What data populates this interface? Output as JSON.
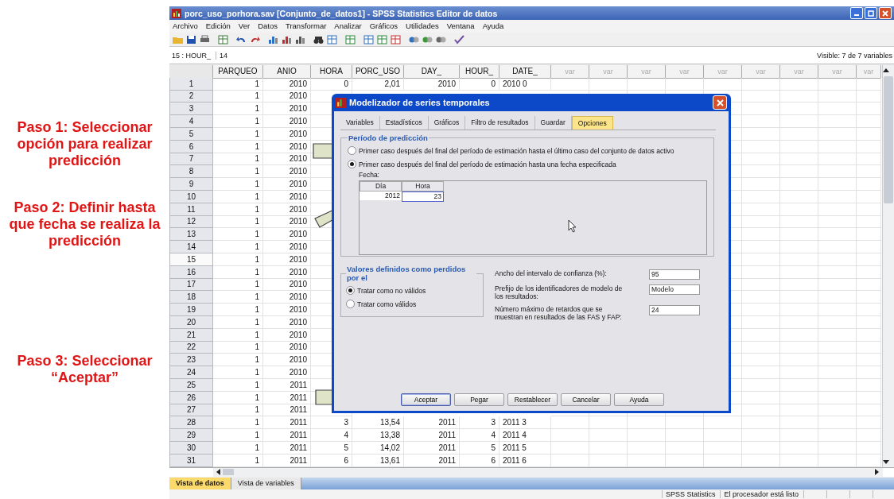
{
  "annotations": [
    "Paso 1: Seleccionar opción para realizar predicción",
    "Paso 2: Definir hasta que fecha se realiza la predicción",
    "Paso 3: Seleccionar “Aceptar”"
  ],
  "window": {
    "title": "porc_uso_porhora.sav [Conjunto_de_datos1] - SPSS Statistics Editor de datos",
    "menu": [
      "Archivo",
      "Edición",
      "Ver",
      "Datos",
      "Transformar",
      "Analizar",
      "Gráficos",
      "Utilidades",
      "Ventana",
      "Ayuda"
    ],
    "cell_ref": "15 : HOUR_",
    "cell_value": "14",
    "visible_info": "Visible: 7 de 7 variables"
  },
  "grid": {
    "columns": [
      "PARQUEO",
      "ANIO",
      "HORA",
      "PORC_USO",
      "DAY_",
      "HOUR_",
      "DATE_",
      "var",
      "var",
      "var",
      "var",
      "var",
      "var",
      "var",
      "var",
      "var"
    ],
    "rows": [
      {
        "n": "1",
        "selected": false,
        "cells": [
          "1",
          "2010",
          "0",
          "2,01",
          "2010",
          "0",
          "2010 0"
        ]
      },
      {
        "n": "2",
        "selected": false,
        "cells": [
          "1",
          "2010"
        ]
      },
      {
        "n": "3",
        "selected": false,
        "cells": [
          "1",
          "2010"
        ]
      },
      {
        "n": "4",
        "selected": false,
        "cells": [
          "1",
          "2010"
        ]
      },
      {
        "n": "5",
        "selected": false,
        "cells": [
          "1",
          "2010"
        ]
      },
      {
        "n": "6",
        "selected": false,
        "cells": [
          "1",
          "2010"
        ]
      },
      {
        "n": "7",
        "selected": false,
        "cells": [
          "1",
          "2010"
        ]
      },
      {
        "n": "8",
        "selected": false,
        "cells": [
          "1",
          "2010"
        ]
      },
      {
        "n": "9",
        "selected": false,
        "cells": [
          "1",
          "2010"
        ]
      },
      {
        "n": "10",
        "selected": false,
        "cells": [
          "1",
          "2010"
        ]
      },
      {
        "n": "11",
        "selected": false,
        "cells": [
          "1",
          "2010"
        ]
      },
      {
        "n": "12",
        "selected": false,
        "cells": [
          "1",
          "2010"
        ]
      },
      {
        "n": "13",
        "selected": false,
        "cells": [
          "1",
          "2010"
        ]
      },
      {
        "n": "14",
        "selected": false,
        "cells": [
          "1",
          "2010"
        ]
      },
      {
        "n": "15",
        "selected": true,
        "cells": [
          "1",
          "2010"
        ]
      },
      {
        "n": "16",
        "selected": false,
        "cells": [
          "1",
          "2010"
        ]
      },
      {
        "n": "17",
        "selected": false,
        "cells": [
          "1",
          "2010"
        ]
      },
      {
        "n": "18",
        "selected": false,
        "cells": [
          "1",
          "2010"
        ]
      },
      {
        "n": "19",
        "selected": false,
        "cells": [
          "1",
          "2010"
        ]
      },
      {
        "n": "20",
        "selected": false,
        "cells": [
          "1",
          "2010"
        ]
      },
      {
        "n": "21",
        "selected": false,
        "cells": [
          "1",
          "2010"
        ]
      },
      {
        "n": "22",
        "selected": false,
        "cells": [
          "1",
          "2010"
        ]
      },
      {
        "n": "23",
        "selected": false,
        "cells": [
          "1",
          "2010"
        ]
      },
      {
        "n": "24",
        "selected": false,
        "cells": [
          "1",
          "2010"
        ]
      },
      {
        "n": "25",
        "selected": false,
        "cells": [
          "1",
          "2011"
        ]
      },
      {
        "n": "26",
        "selected": false,
        "cells": [
          "1",
          "2011"
        ]
      },
      {
        "n": "27",
        "selected": false,
        "cells": [
          "1",
          "2011"
        ]
      },
      {
        "n": "28",
        "selected": false,
        "cells": [
          "1",
          "2011",
          "3",
          "13,54",
          "2011",
          "3",
          "2011 3"
        ]
      },
      {
        "n": "29",
        "selected": false,
        "cells": [
          "1",
          "2011",
          "4",
          "13,38",
          "2011",
          "4",
          "2011 4"
        ]
      },
      {
        "n": "30",
        "selected": false,
        "cells": [
          "1",
          "2011",
          "5",
          "14,02",
          "2011",
          "5",
          "2011 5"
        ]
      },
      {
        "n": "31",
        "selected": false,
        "cells": [
          "1",
          "2011",
          "6",
          "13,61",
          "2011",
          "6",
          "2011 6"
        ]
      }
    ]
  },
  "view_tabs": [
    {
      "label": "Vista de datos",
      "selected": true
    },
    {
      "label": "Vista de variables",
      "selected": false
    }
  ],
  "status_bar": [
    "SPSS Statistics",
    "El procesador está listo"
  ],
  "dialog": {
    "title": "Modelizador de series temporales",
    "tabs": [
      {
        "label": "Variables",
        "selected": false
      },
      {
        "label": "Estadísticos",
        "selected": false
      },
      {
        "label": "Gráficos",
        "selected": false
      },
      {
        "label": "Filtro de resultados",
        "selected": false
      },
      {
        "label": "Guardar",
        "selected": false
      },
      {
        "label": "Opciones",
        "selected": true
      }
    ],
    "prediction": {
      "title": "Período de predicción",
      "options": [
        {
          "label": "Primer caso después del final del período de estimación hasta el último caso del conjunto de datos activo",
          "selected": false
        },
        {
          "label": "Primer caso después del final del período de estimación hasta una fecha especificada",
          "selected": true
        }
      ],
      "date_label": "Fecha:",
      "date_columns": [
        "Día",
        "Hora"
      ],
      "date_values": [
        "2012",
        "23"
      ]
    },
    "missing": {
      "title": "Valores definidos como perdidos por el",
      "options": [
        {
          "label": "Tratar como no válidos",
          "selected": true
        },
        {
          "label": "Tratar como válidos",
          "selected": false
        }
      ]
    },
    "settings": [
      {
        "label": "Ancho del intervalo de confianza (%):",
        "value": "95"
      },
      {
        "label": "Prefijo de los identificadores de modelo de los resultados:",
        "value": "Modelo"
      },
      {
        "label": "Número máximo de retardos que se muestran en resultados de las FAS y FAP:",
        "value": "24"
      }
    ],
    "buttons": [
      {
        "label": "Aceptar",
        "default": true
      },
      {
        "label": "Pegar",
        "default": false
      },
      {
        "label": "Restablecer",
        "default": false
      },
      {
        "label": "Cancelar",
        "default": false
      },
      {
        "label": "Ayuda",
        "default": false
      }
    ]
  }
}
